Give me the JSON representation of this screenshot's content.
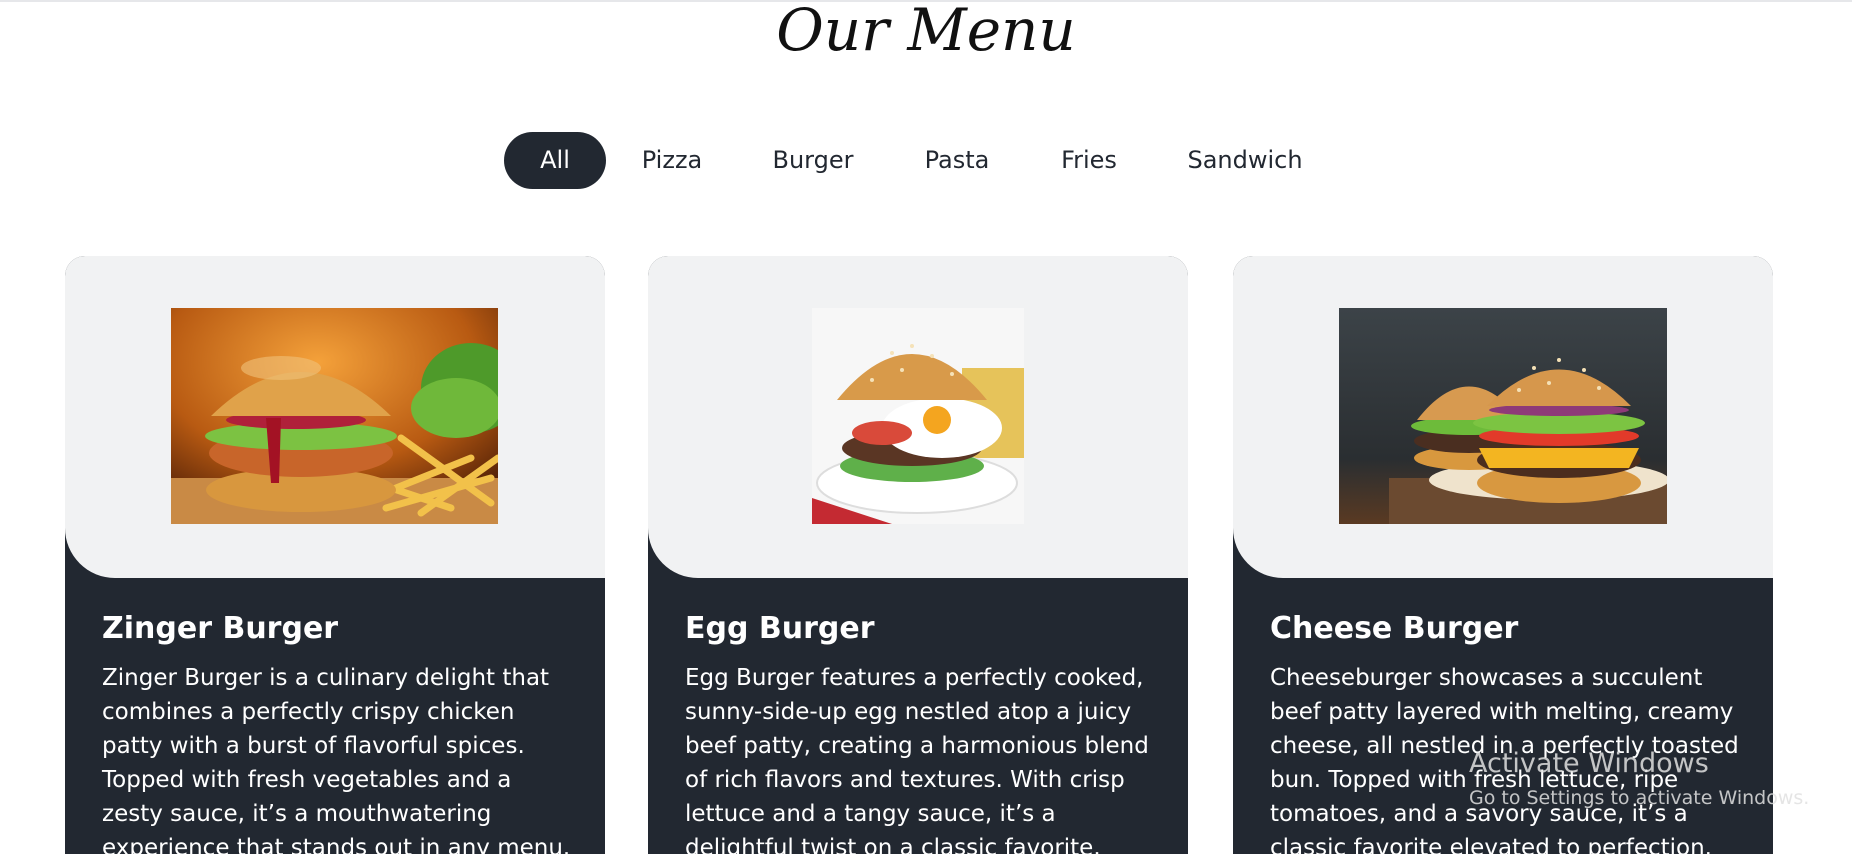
{
  "page": {
    "title": "Our Menu"
  },
  "filters": [
    {
      "label": "All",
      "active": true
    },
    {
      "label": "Pizza",
      "active": false
    },
    {
      "label": "Burger",
      "active": false
    },
    {
      "label": "Pasta",
      "active": false
    },
    {
      "label": "Fries",
      "active": false
    },
    {
      "label": "Sandwich",
      "active": false
    }
  ],
  "cards": [
    {
      "name": "Zinger Burger",
      "description": "Zinger Burger is a culinary delight that combines a perfectly crispy chicken patty with a burst of flavorful spices. Topped with fresh vegetables and a zesty sauce, it’s a mouthwatering experience that stands out in any menu.",
      "image": "zinger-burger-photo"
    },
    {
      "name": "Egg Burger",
      "description": "Egg Burger features a perfectly cooked, sunny-side-up egg nestled atop a juicy beef patty, creating a harmonious blend of rich flavors and textures. With crisp lettuce and a tangy sauce, it’s a delightful twist on a classic favorite.",
      "image": "egg-burger-photo"
    },
    {
      "name": "Cheese Burger",
      "description": "Cheeseburger showcases a succulent beef patty layered with melting, creamy cheese, all nestled in a perfectly toasted bun. Topped with fresh lettuce, ripe tomatoes, and a savory sauce, it’s a classic favorite elevated to perfection.",
      "image": "cheese-burger-photo"
    }
  ],
  "watermark": {
    "line1": "Activate Windows",
    "line2": "Go to Settings to activate Windows."
  },
  "colors": {
    "dark": "#222831",
    "card_top": "#f1f2f3",
    "text_on_dark": "#ffffff"
  }
}
